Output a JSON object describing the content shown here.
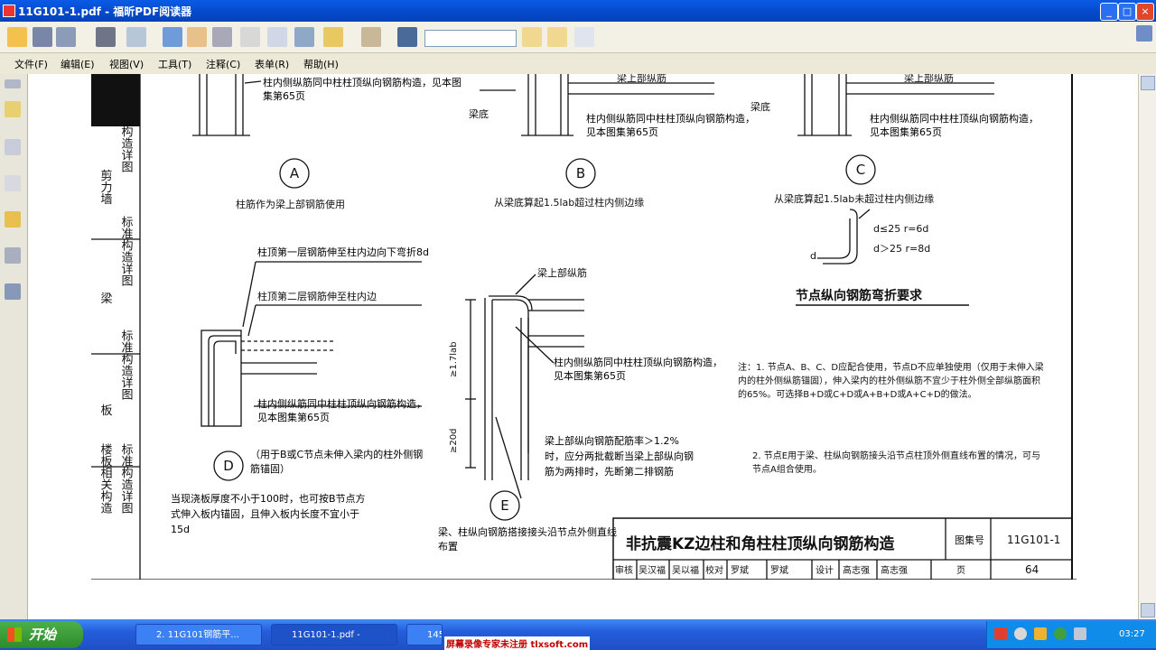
{
  "window": {
    "title": "11G101-1.pdf - 福昕PDF阅读器",
    "minimize": "_",
    "maximize": "□",
    "close": "×"
  },
  "menu": [
    "文件(F)",
    "编辑(E)",
    "视图(V)",
    "工具(T)",
    "注释(C)",
    "表单(R)",
    "帮助(H)"
  ],
  "search": {
    "value": ""
  },
  "sidebar_labels": [
    {
      "group": "剪力墙",
      "col": "标准构造详图"
    },
    {
      "group": "梁",
      "col": "标准构造详图"
    },
    {
      "group": "板",
      "col": "标准构造详图"
    },
    {
      "group": "楼板相关构造",
      "col": "标准构造详图"
    }
  ],
  "detail": {
    "a_note": "柱内侧纵筋同中柱柱顶纵向钢筋构造，见本图集第65页",
    "a_label": "A",
    "a_caption": "柱筋作为梁上部钢筋使用",
    "b_beam_top": "梁上部纵筋",
    "b_beam_bottom": "梁底",
    "b_note": "柱内侧纵筋同中柱柱顶纵向钢筋构造，见本图集第65页",
    "b_label": "B",
    "b_caption": "从梁底算起1.5lab超过柱内侧边缘",
    "c_beam_top": "梁上部纵筋",
    "c_beam_bottom": "梁底",
    "c_note": "柱内侧纵筋同中柱柱顶纵向钢筋构造，见本图集第65页",
    "c_label": "C",
    "c_caption": "从梁底算起1.5lab未超过柱内侧边缘",
    "bend_d1": "d≤25   r=6d",
    "bend_d2": "d＞25   r=8d",
    "bend_d": "d",
    "bend_title": "节点纵向钢筋弯折要求",
    "d_note1": "柱顶第一层钢筋伸至柱内边向下弯折8d",
    "d_note2": "柱顶第二层钢筋伸至柱内边",
    "d_note3": "柱内侧纵筋同中柱柱顶纵向钢筋构造，见本图集第65页",
    "d_label": "D",
    "d_caption": "（用于B或C节点未伸入梁内的柱外侧钢筋锚固）",
    "d_slab_note": "当现浇板厚度不小于100时，也可按B节点方式伸入板内锚固，且伸入板内长度不宜小于15d",
    "e_beam_top": "梁上部纵筋",
    "e_dim1": "≥1.7lab",
    "e_dim2": "≥20d",
    "e_note1": "柱内侧纵筋同中柱柱顶纵向钢筋构造，见本图集第65页",
    "e_note2": "梁上部纵向钢筋配筋率＞1.2%时，应分两批截断当梁上部纵向钢筋为两排时，先断第二排钢筋",
    "e_label": "E",
    "e_caption": "梁、柱纵向钢筋搭接接头沿节点外侧直线布置",
    "notes": [
      "注：1. 节点A、B、C、D应配合使用，节点D不应单独使用（仅用于未伸入梁内的柱外侧纵筋锚固），伸入梁内的柱外侧纵筋不宜少于柱外侧全部纵筋面积的65%。可选择B+D或C+D或A+B+D或A+C+D的做法。",
      "2. 节点E用于梁、柱纵向钢筋接头沿节点柱顶外侧直线布置的情况，可与节点A组合使用。"
    ]
  },
  "titleblock": {
    "title": "非抗震KZ边柱和角柱柱顶纵向钢筋构造",
    "atlas_label": "图集号",
    "atlas_no": "11G101-1",
    "row": [
      "审核",
      "吴汉福",
      "吴以福",
      "校对",
      "罗斌",
      "罗斌",
      "设计",
      "高志强",
      "高志强",
      "页"
    ],
    "page": "64"
  },
  "taskbar": {
    "start": "开始",
    "tasks": [
      "2. 11G101钢筋平...",
      "11G101-1.pdf -",
      "145"
    ],
    "clock": "03:27"
  },
  "watermark": "屏幕录像专家未注册 tlxsoft.com"
}
